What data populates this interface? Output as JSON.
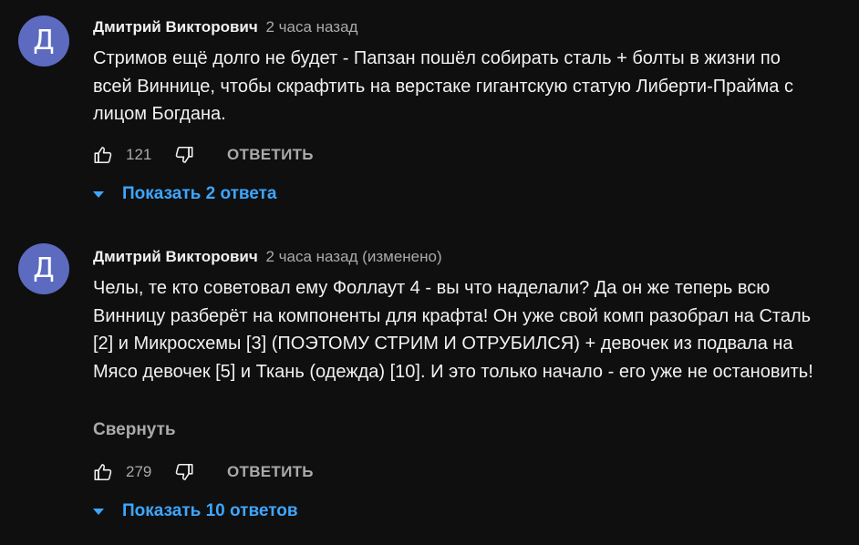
{
  "comments": [
    {
      "avatar_letter": "Д",
      "author": "Дмитрий Викторович",
      "meta": "2 часа назад",
      "text": "Стримов ещё долго не будет - Папзан пошёл собирать сталь + болты в жизни по всей Виннице, чтобы скрафтить на верстаке гигантскую статую Либерти-Прайма с лицом Богдана.",
      "likes": "121",
      "reply_label": "ОТВЕТИТЬ",
      "replies_label": "Показать 2 ответа"
    },
    {
      "avatar_letter": "Д",
      "author": "Дмитрий Викторович",
      "meta": "2 часа назад (изменено)",
      "text": "Челы, те кто советовал ему Фоллаут 4 - вы что наделали? Да он же теперь всю Винницу разберёт на компоненты для крафта! Он уже свой комп разобрал на Сталь [2] и Микросхемы [3] (ПОЭТОМУ СТРИМ И ОТРУБИЛСЯ) + девочек из подвала на Мясо девочек [5] и Ткань (одежда) [10]. И это только начало - его уже не остановить!",
      "collapse_label": "Свернуть",
      "likes": "279",
      "reply_label": "ОТВЕТИТЬ",
      "replies_label": "Показать 10 ответов"
    }
  ],
  "icons": {
    "like": "thumbs-up-icon",
    "dislike": "thumbs-down-icon",
    "expand": "caret-down-icon"
  },
  "colors": {
    "background": "#0f0f0f",
    "avatar": "#5c6bc0",
    "link": "#3ea6ff",
    "secondary_text": "#aaaaaa"
  }
}
